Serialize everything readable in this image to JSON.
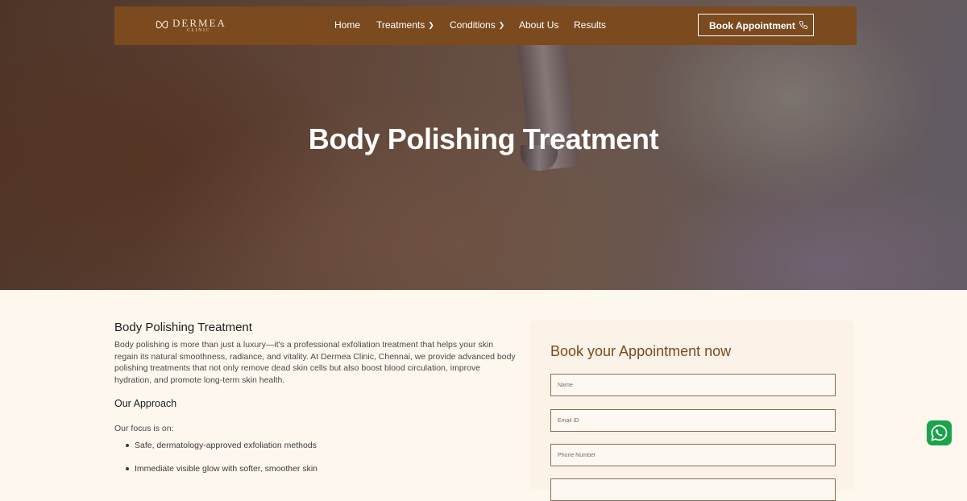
{
  "brand": {
    "name": "DERMEA",
    "sub": "CLINIC"
  },
  "nav": {
    "items": [
      {
        "label": "Home"
      },
      {
        "label": "Treatments"
      },
      {
        "label": "Conditions"
      },
      {
        "label": "About Us"
      },
      {
        "label": "Results"
      }
    ],
    "cta": "Book Appointment"
  },
  "hero": {
    "title": "Body Polishing Treatment"
  },
  "article": {
    "heading": "Body Polishing Treatment",
    "description": "Body polishing is more than just a luxury—it's a professional exfoliation treatment that helps your skin regain its natural smoothness, radiance, and vitality. At Dermea Clinic, Chennai, we provide advanced body polishing treatments that not only remove dead skin cells but also boost blood circulation, improve hydration, and promote long-term skin health.",
    "approach_heading": "Our Approach",
    "focus_intro": "Our focus is on:",
    "bullets": [
      "Safe, dermatology-approved exfoliation methods",
      "Immediate visible glow with softer, smoother skin"
    ]
  },
  "form": {
    "title": "Book your Appointment now",
    "fields": [
      {
        "placeholder": "Name",
        "value": ""
      },
      {
        "placeholder": "Email ID",
        "value": ""
      },
      {
        "placeholder": "Phone Number",
        "value": ""
      }
    ]
  },
  "colors": {
    "brand_brown": "#7b4a1e",
    "page_bg": "#fdf7ee",
    "whatsapp_green": "#1aa34a"
  },
  "icons": {
    "logo": "butterfly-icon",
    "nav_dropdown": "chevron-down-icon",
    "cta": "phone-icon",
    "floating": "whatsapp-icon"
  }
}
